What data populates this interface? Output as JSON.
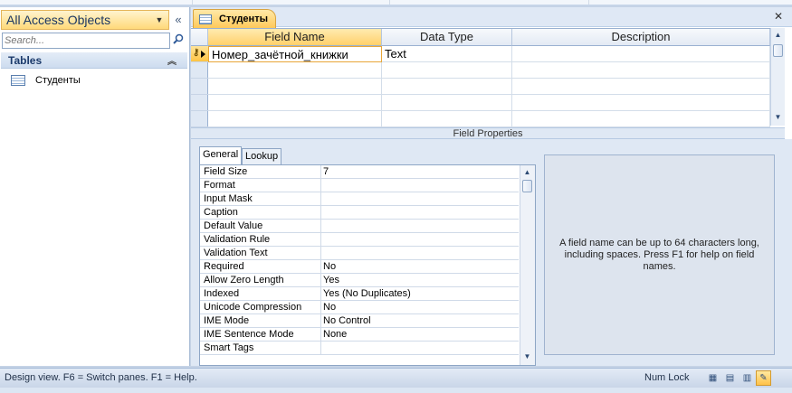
{
  "nav": {
    "title": "All Access Objects",
    "collapse_icon": "double-chevron-left-icon",
    "search_placeholder": "Search...",
    "group_label": "Tables",
    "items": [
      {
        "label": "Студенты",
        "icon": "table-icon"
      }
    ]
  },
  "document": {
    "tab_label": "Студенты",
    "close_glyph": "✕"
  },
  "design_grid": {
    "columns": [
      "Field Name",
      "Data Type",
      "Description"
    ],
    "rows": [
      {
        "field_name": "Номер_зачётной_книжки",
        "data_type": "Text",
        "description": "",
        "primary_key": true
      }
    ]
  },
  "field_properties": {
    "title": "Field Properties",
    "tabs": [
      "General",
      "Lookup"
    ],
    "active_tab": "General",
    "properties": [
      {
        "name": "Field Size",
        "value": "7"
      },
      {
        "name": "Format",
        "value": ""
      },
      {
        "name": "Input Mask",
        "value": ""
      },
      {
        "name": "Caption",
        "value": ""
      },
      {
        "name": "Default Value",
        "value": ""
      },
      {
        "name": "Validation Rule",
        "value": ""
      },
      {
        "name": "Validation Text",
        "value": ""
      },
      {
        "name": "Required",
        "value": "No"
      },
      {
        "name": "Allow Zero Length",
        "value": "Yes"
      },
      {
        "name": "Indexed",
        "value": "Yes (No Duplicates)"
      },
      {
        "name": "Unicode Compression",
        "value": "No"
      },
      {
        "name": "IME Mode",
        "value": "No Control"
      },
      {
        "name": "IME Sentence Mode",
        "value": "None"
      },
      {
        "name": "Smart Tags",
        "value": ""
      }
    ],
    "help_text": "A field name can be up to 64 characters long, including spaces. Press F1 for help on field names."
  },
  "status_bar": {
    "text": "Design view.  F6 = Switch panes.  F1 = Help.",
    "num_lock": "Num Lock",
    "view_buttons": [
      "datasheet-view-icon",
      "pivot-table-view-icon",
      "pivot-chart-view-icon",
      "design-view-icon"
    ],
    "active_view": "design-view-icon"
  },
  "colors": {
    "accent_active": "#ffc95a",
    "pane_background": "#dfe8f4",
    "border_blue": "#8ea6c5"
  }
}
